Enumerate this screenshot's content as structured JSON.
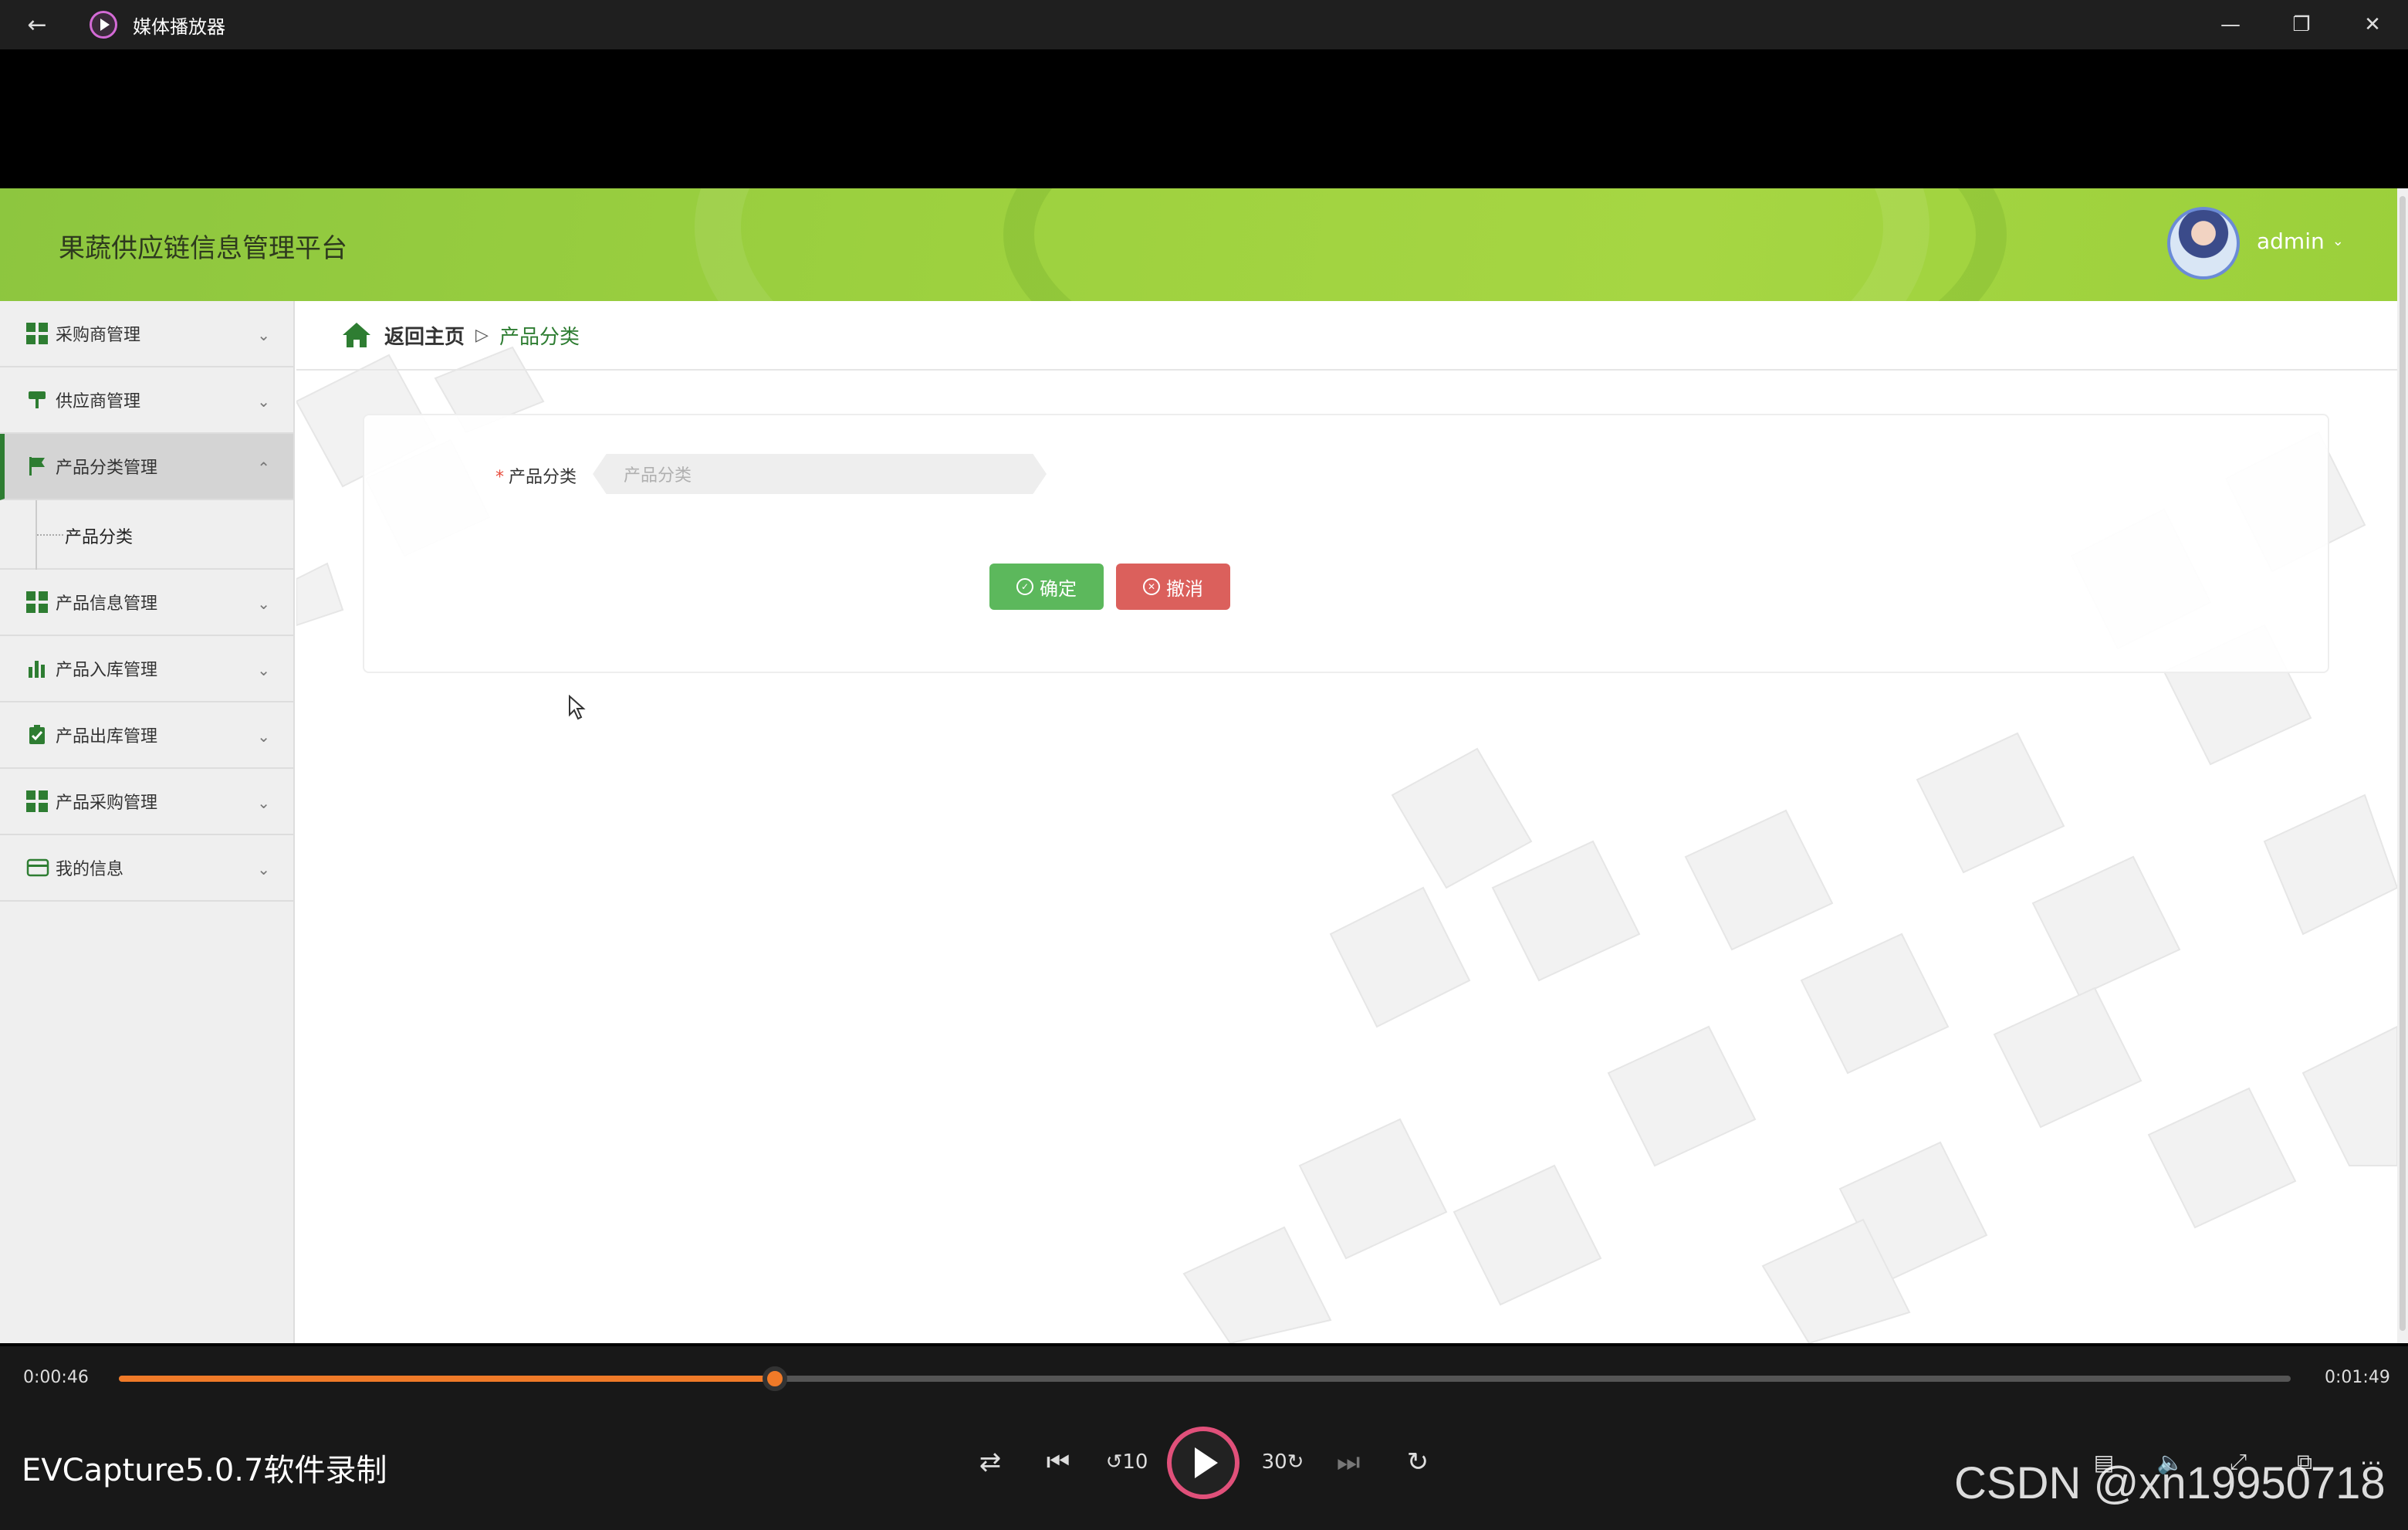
{
  "window": {
    "title": "媒体播放器"
  },
  "app": {
    "brand": "果蔬供应链信息管理平台",
    "user": "admin"
  },
  "sidebar": {
    "items": [
      {
        "label": "采购商管理",
        "icon": "grid-icon"
      },
      {
        "label": "供应商管理",
        "icon": "paint-roller-icon"
      },
      {
        "label": "产品分类管理",
        "icon": "flag-icon"
      },
      {
        "label": "产品信息管理",
        "icon": "grid-icon"
      },
      {
        "label": "产品入库管理",
        "icon": "bar-chart-icon"
      },
      {
        "label": "产品出库管理",
        "icon": "clipboard-check-icon"
      },
      {
        "label": "产品采购管理",
        "icon": "grid-icon"
      },
      {
        "label": "我的信息",
        "icon": "card-icon"
      }
    ],
    "sub_item": "产品分类"
  },
  "breadcrumb": {
    "home": "返回主页",
    "current": "产品分类"
  },
  "form": {
    "label": "产品分类",
    "required_mark": "*",
    "placeholder": "产品分类",
    "confirm": "确定",
    "cancel": "撤消"
  },
  "player": {
    "current_time": "0:00:46",
    "total_time": "0:01:49",
    "progress": 0.302,
    "caption": "EVCapture5.0.7软件录制",
    "watermark": "CSDN @xn19950718"
  },
  "colors": {
    "accent": "#2e7d32",
    "header": "#9dd13f",
    "confirm": "#5cb85c",
    "cancel": "#d9534f",
    "progress": "#f07a28"
  }
}
